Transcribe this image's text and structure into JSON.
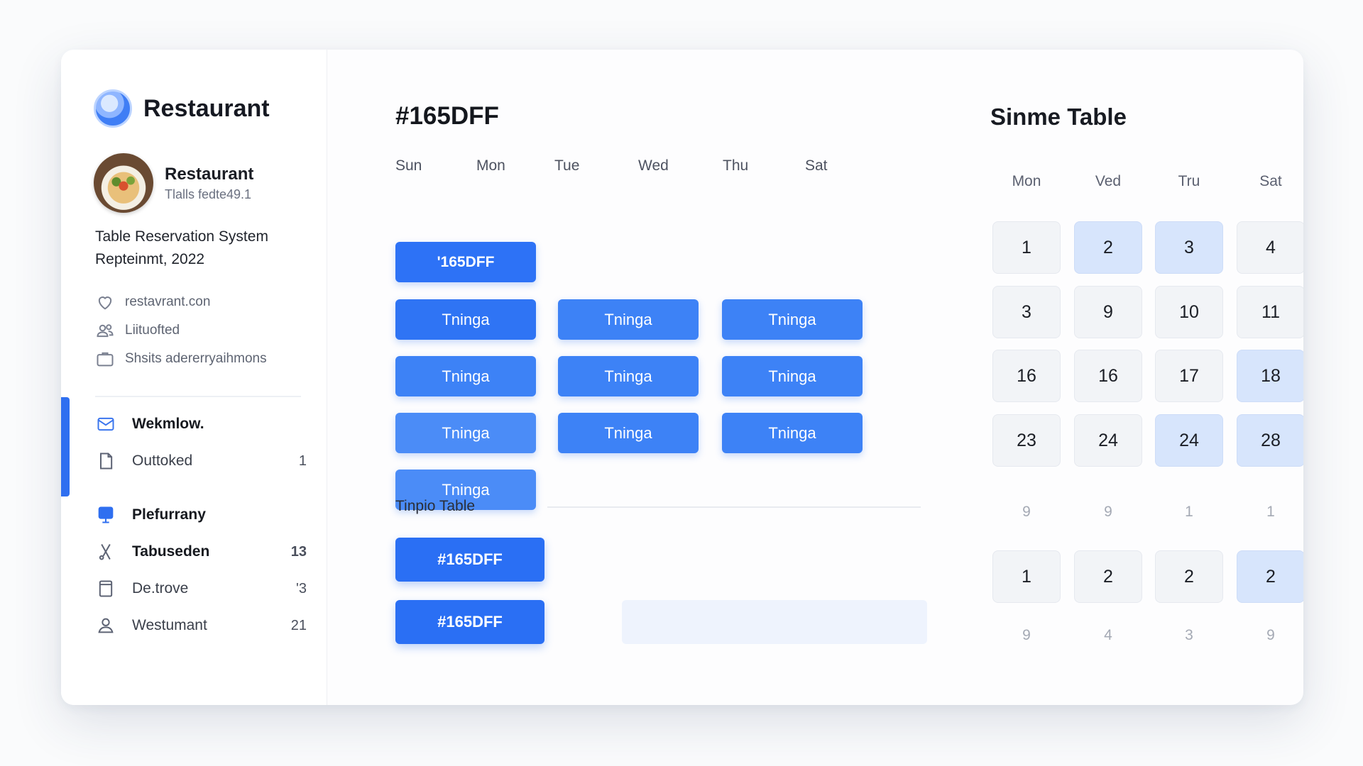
{
  "sidebar": {
    "brand_title": "Restaurant",
    "profile": {
      "name": "Restaurant",
      "subtitle": "Tlalls fedte49.1"
    },
    "system_title_line1": "Table Reservation System",
    "system_title_line2": "Repteinmt, 2022",
    "info": [
      {
        "icon": "heart-icon",
        "text": "restavrant.con"
      },
      {
        "icon": "users-icon",
        "text": "Liituofted"
      },
      {
        "icon": "briefcase-icon",
        "text": "Shsits adererryaihmons"
      }
    ],
    "nav": [
      {
        "icon": "mail-icon",
        "label": "Wekmlow.",
        "count": ""
      },
      {
        "icon": "document-icon",
        "label": "Outtoked",
        "count": "1"
      },
      {
        "icon": "board-icon",
        "label": "Plefurrany",
        "count": ""
      },
      {
        "icon": "scissors-icon",
        "label": "Tabuseden",
        "count": "13"
      },
      {
        "icon": "book-icon",
        "label": "De.trove",
        "count": "'3"
      },
      {
        "icon": "user-icon",
        "label": "Westumant",
        "count": "21"
      }
    ]
  },
  "main": {
    "title": "#165DFF",
    "days": [
      "Sun",
      "Mon",
      "Tue",
      "Wed",
      "Thu",
      "Sat"
    ],
    "header_slot": "'165DFF",
    "slot_label": "Tninga",
    "section_label": "Tinpio Table",
    "buttons": [
      "#165DFF",
      "#165DFF"
    ]
  },
  "calendar": {
    "title": "Sinme Table",
    "headers": [
      "Mon",
      "Ved",
      "Tru",
      "Sat"
    ],
    "rows": [
      [
        "1",
        "2",
        "3",
        "4"
      ],
      [
        "3",
        "9",
        "10",
        "11"
      ],
      [
        "16",
        "16",
        "17",
        "18"
      ],
      [
        "23",
        "24",
        "24",
        "28"
      ]
    ],
    "plain_row_1": [
      "9",
      "9",
      "1",
      "1"
    ],
    "last_row": [
      "1",
      "2",
      "2",
      "2"
    ],
    "plain_row_2": [
      "9",
      "4",
      "3",
      "9"
    ]
  },
  "colors": {
    "accent": "#2f6ff0",
    "highlight_cell": "#d7e5fc"
  }
}
